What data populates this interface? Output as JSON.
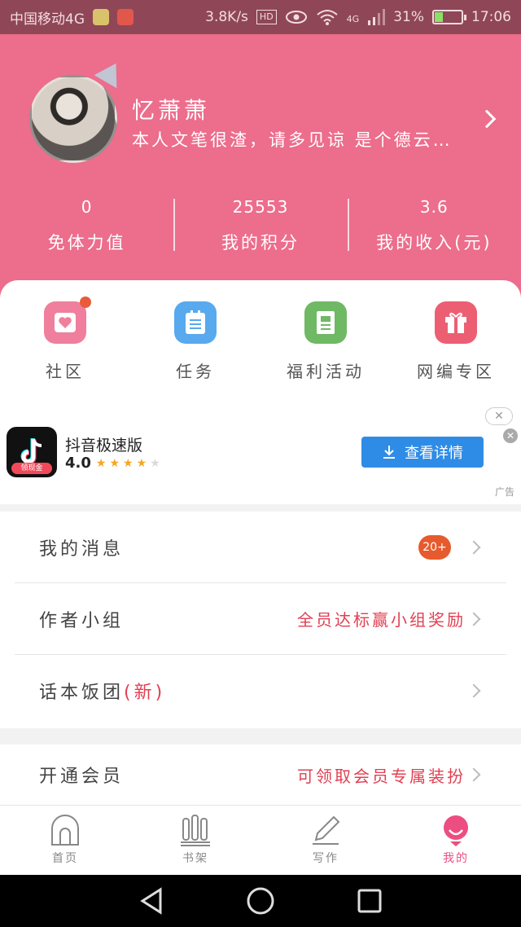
{
  "status_bar": {
    "carrier": "中国移动4G",
    "speed": "3.8K/s",
    "hd": "HD",
    "network": "4G",
    "battery": "31%",
    "time": "17:06"
  },
  "profile": {
    "nickname": "忆萧萧",
    "bio": "本人文笔很渣，请多见谅 是个德云…"
  },
  "stats": [
    {
      "value": "0",
      "label": "免体力值"
    },
    {
      "value": "25553",
      "label": "我的积分"
    },
    {
      "value": "3.6",
      "label": "我的收入(元)"
    }
  ],
  "quick_actions": [
    {
      "label": "社区",
      "icon": "heart-card-icon",
      "color": "#ef7f9d",
      "has_dot": true
    },
    {
      "label": "任务",
      "icon": "clipboard-icon",
      "color": "#58a9ee",
      "has_dot": false
    },
    {
      "label": "福利活动",
      "icon": "document-icon",
      "color": "#6fb964",
      "has_dot": false
    },
    {
      "label": "网编专区",
      "icon": "gift-icon",
      "color": "#ec5f73",
      "has_dot": false
    }
  ],
  "ad": {
    "app_name": "抖音极速版",
    "rating": "4.0",
    "stars_on": 4,
    "stars_total": 5,
    "icon_badge": "领现金",
    "cta": "查看详情",
    "tag": "广告"
  },
  "menu_group_1": {
    "messages": {
      "label": "我的消息",
      "badge": "20+"
    },
    "author_group": {
      "label": "作者小组",
      "right": "全员达标赢小组奖励"
    },
    "rice_group": {
      "label": "话本饭团",
      "suffix": "(新)"
    }
  },
  "menu_group_2": {
    "vip": {
      "label": "开通会员",
      "right": "可领取会员专属装扮"
    }
  },
  "tabbar": [
    {
      "label": "首页",
      "icon": "home-icon",
      "active": false
    },
    {
      "label": "书架",
      "icon": "bookshelf-icon",
      "active": false
    },
    {
      "label": "写作",
      "icon": "pen-icon",
      "active": false
    },
    {
      "label": "我的",
      "icon": "profile-icon",
      "active": true
    }
  ],
  "colors": {
    "header_pink": "#ec6d8c",
    "status_bar": "#8f4757",
    "accent_red": "#e04053",
    "active_tab": "#ec4e82",
    "ad_button": "#2f8ce6"
  }
}
